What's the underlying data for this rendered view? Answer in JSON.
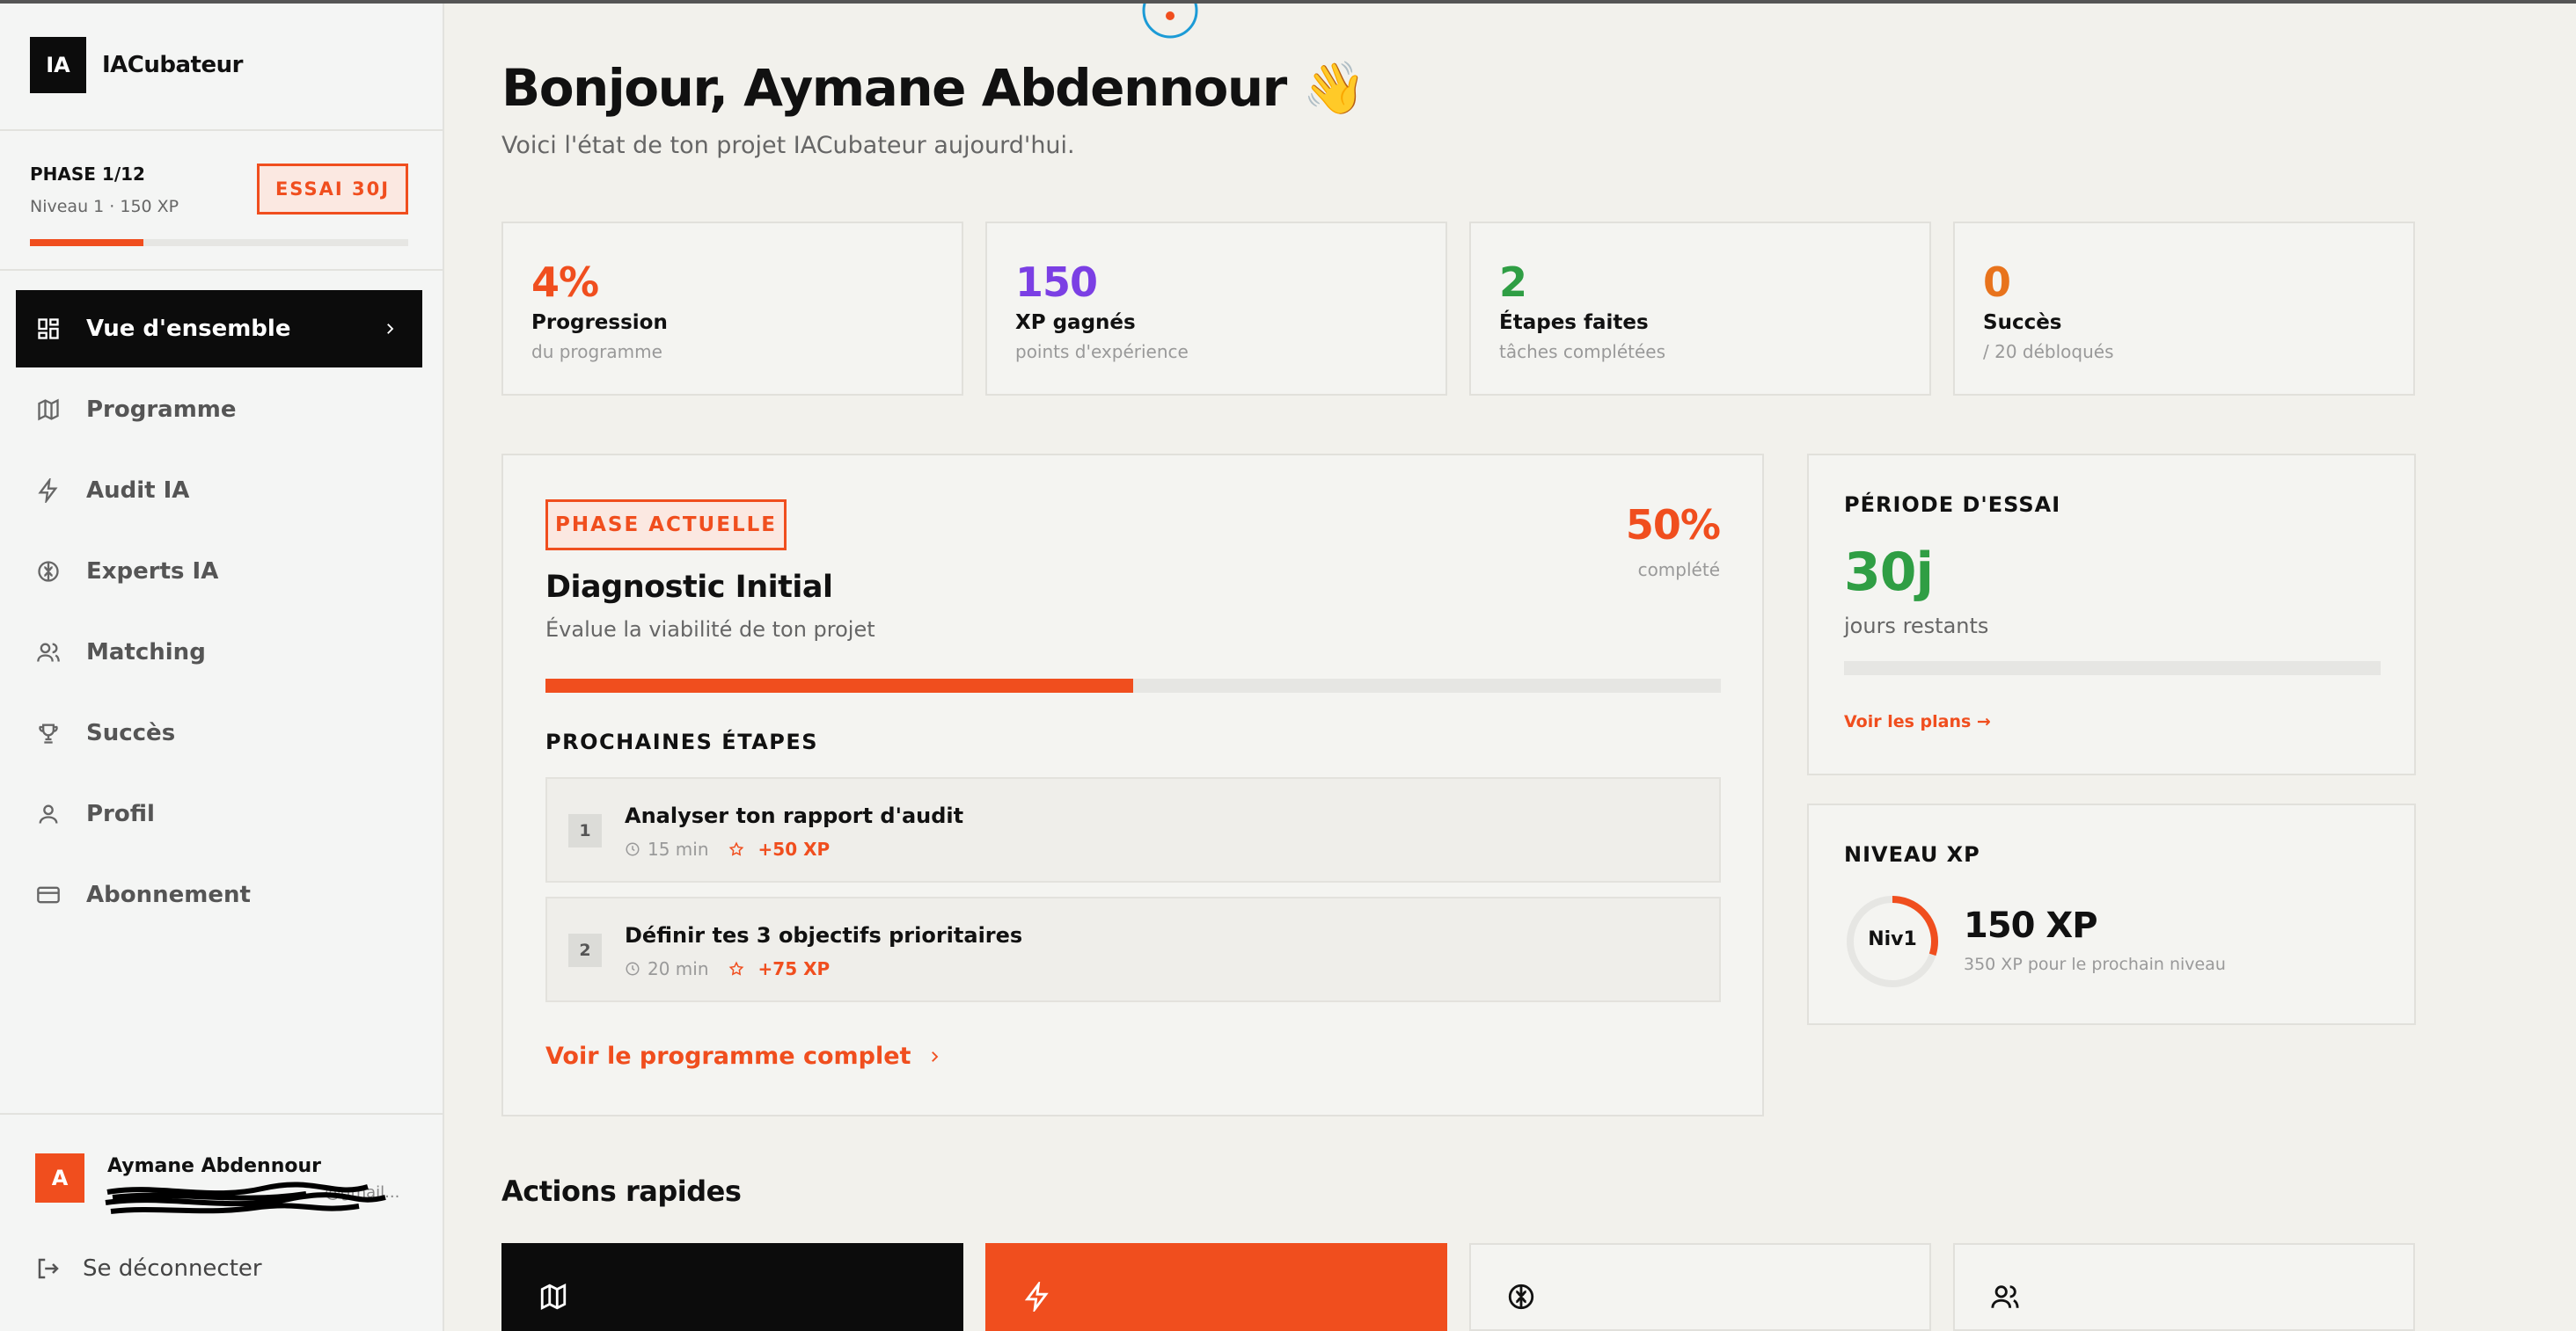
{
  "brand": {
    "logo": "IA",
    "name": "IACubateur"
  },
  "sidebar_phase": {
    "title": "PHASE 1/12",
    "sub": "Niveau 1 · 150 XP",
    "badge": "ESSAI 30J",
    "progress_fraction": 0.3
  },
  "nav": {
    "items": [
      {
        "label": "Vue d'ensemble",
        "icon": "dashboard-icon",
        "active": true
      },
      {
        "label": "Programme",
        "icon": "map-icon"
      },
      {
        "label": "Audit IA",
        "icon": "lightning-icon"
      },
      {
        "label": "Experts IA",
        "icon": "brain-icon"
      },
      {
        "label": "Matching",
        "icon": "users-icon"
      },
      {
        "label": "Succès",
        "icon": "trophy-icon"
      },
      {
        "label": "Profil",
        "icon": "user-icon"
      },
      {
        "label": "Abonnement",
        "icon": "credit-card-icon"
      }
    ]
  },
  "user": {
    "initial": "A",
    "name": "Aymane Abdennour",
    "email_visible": "...@gmail..."
  },
  "logout_label": "Se déconnecter",
  "header": {
    "greeting": "Bonjour, Aymane Abdennour 👋",
    "subtitle": "Voici l'état de ton projet IACubateur aujourd'hui."
  },
  "stats": [
    {
      "value": "4%",
      "label": "Progression",
      "sub": "du programme",
      "color": "#f04e1e"
    },
    {
      "value": "150",
      "label": "XP gagnés",
      "sub": "points d'expérience",
      "color": "#7b3fe4"
    },
    {
      "value": "2",
      "label": "Étapes faites",
      "sub": "tâches complétées",
      "color": "#2f9e44"
    },
    {
      "value": "0",
      "label": "Succès",
      "sub": "/ 20 débloqués",
      "color": "#e8731c"
    }
  ],
  "phase_card": {
    "badge": "PHASE ACTUELLE",
    "percent": "50%",
    "percent_sub": "complété",
    "title": "Diagnostic Initial",
    "subtitle": "Évalue la viabilité de ton projet",
    "progress_fraction": 0.5,
    "next_title": "PROCHAINES ÉTAPES",
    "steps": [
      {
        "num": "1",
        "title": "Analyser ton rapport d'audit",
        "time": "15 min",
        "xp": "+50 XP"
      },
      {
        "num": "2",
        "title": "Définir tes 3 objectifs prioritaires",
        "time": "20 min",
        "xp": "+75 XP"
      }
    ],
    "link": "Voir le programme complet"
  },
  "trial_card": {
    "title": "PÉRIODE D'ESSAI",
    "value": "30j",
    "sub": "jours restants",
    "progress_fraction": 0,
    "link": "Voir les plans →"
  },
  "xp_card": {
    "title": "NIVEAU XP",
    "level": "Niv1",
    "value": "150 XP",
    "sub": "350 XP pour le prochain niveau",
    "ring_fraction": 0.3
  },
  "quick_actions": {
    "title": "Actions rapides",
    "items": [
      {
        "icon": "map-icon",
        "style": "dark"
      },
      {
        "icon": "lightning-icon",
        "style": "orange"
      },
      {
        "icon": "brain-icon",
        "style": "light"
      },
      {
        "icon": "users-icon",
        "style": "light"
      }
    ]
  },
  "colors": {
    "accent": "#f04e1e",
    "dark": "#0c0c0c",
    "green": "#2f9e44",
    "purple": "#7b3fe4",
    "amber": "#e8731c"
  }
}
